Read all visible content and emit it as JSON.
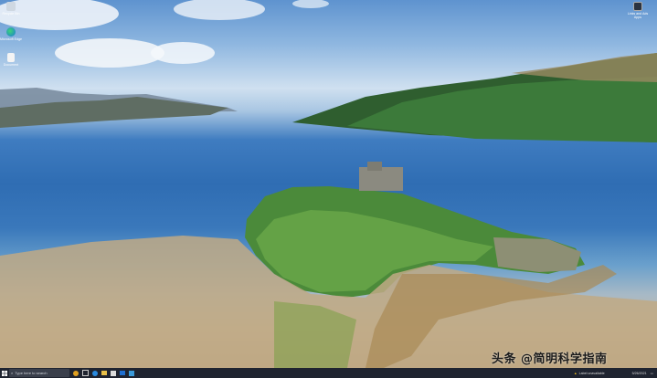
{
  "desktop": {
    "icons": [
      {
        "label": "Recycle Bin"
      },
      {
        "label": "Microsoft Edge"
      },
      {
        "label": "Document"
      }
    ],
    "right_icon": {
      "label": "Links and Ads Apps"
    }
  },
  "taskbar": {
    "search_placeholder": "Type here to search",
    "notification": "Label unavailable",
    "clock": "5/26/2021"
  },
  "watermark": "头条 @简明科学指南"
}
